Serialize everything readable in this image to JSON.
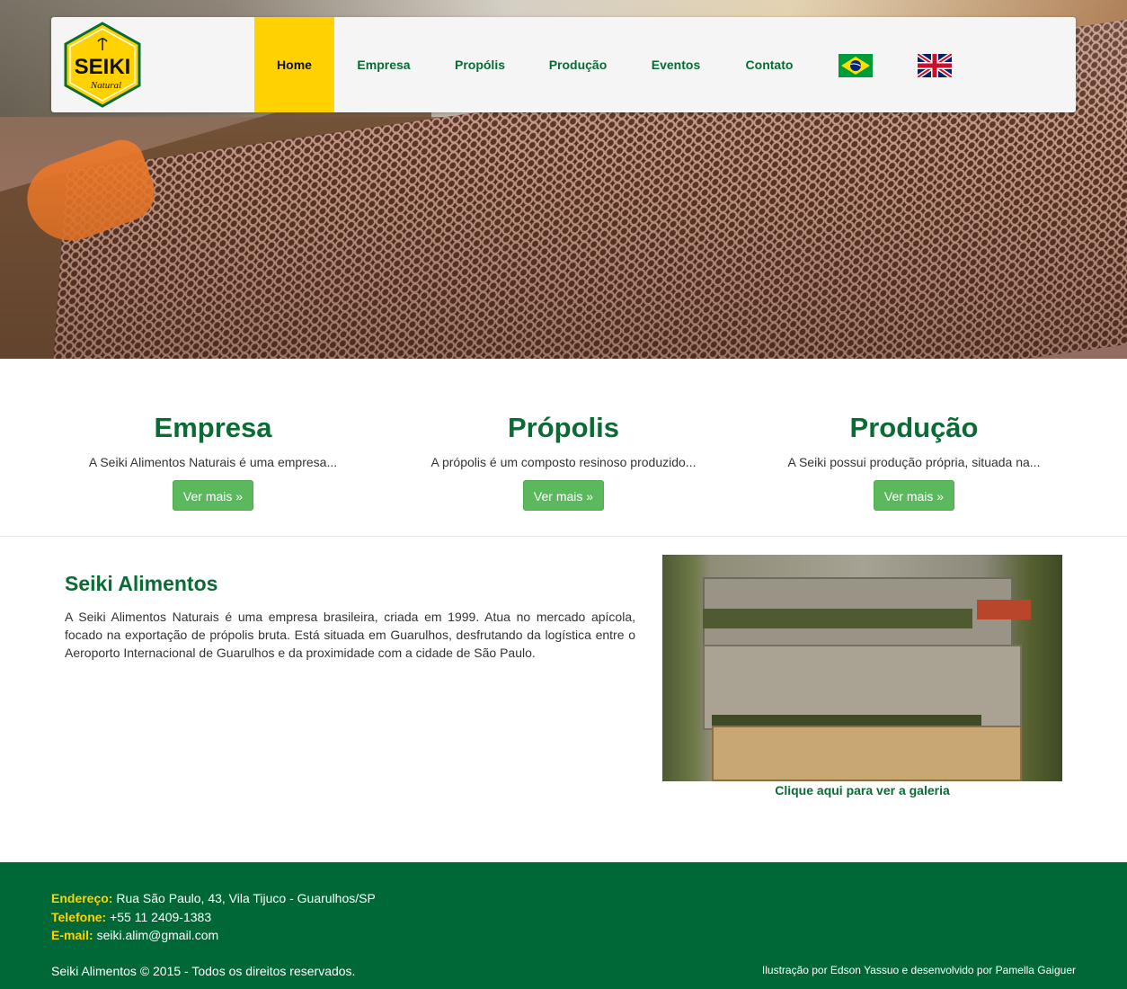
{
  "nav": {
    "logo_text": "SEIKI",
    "logo_subtext": "Natural",
    "items": [
      {
        "label": "Home",
        "active": true
      },
      {
        "label": "Empresa",
        "active": false
      },
      {
        "label": "Propólis",
        "active": false
      },
      {
        "label": "Produção",
        "active": false
      },
      {
        "label": "Eventos",
        "active": false
      },
      {
        "label": "Contato",
        "active": false
      }
    ],
    "flags": [
      "brazil-flag",
      "uk-flag"
    ]
  },
  "features": [
    {
      "title": "Empresa",
      "text": "A Seiki Alimentos Naturais é uma empresa...",
      "button": "Ver mais »"
    },
    {
      "title": "Própolis",
      "text": "A própolis é um composto resinoso produzido...",
      "button": "Ver mais »"
    },
    {
      "title": "Produção",
      "text": "A Seiki possui produção própria, situada na...",
      "button": "Ver mais »"
    }
  ],
  "about": {
    "title": "Seiki Alimentos",
    "text": "A Seiki Alimentos Naturais é uma empresa brasileira, criada em 1999. Atua no mercado apícola, focado na exportação de própolis bruta. Está situada em Guarulhos, desfrutando da logística entre o Aeroporto Internacional de Guarulhos e da proximidade com a cidade de São Paulo.",
    "gallery_link": "Clique aqui para ver a galeria"
  },
  "footer": {
    "address_label": "Endereço:",
    "address": "Rua São Paulo, 43, Vila Tijuco - Guarulhos/SP",
    "phone_label": "Telefone:",
    "phone": "+55 11 2409-1383",
    "email_label": "E-mail:",
    "email": "seiki.alim@gmail.com",
    "copyright": "Seiki Alimentos © 2015 - Todos os direitos reservados.",
    "credits": "Ilustração por Edson Yassuo e desenvolvido por Pamella Gaiguer"
  },
  "colors": {
    "brand_green": "#0a6b34",
    "footer_green": "#006837",
    "accent_yellow": "#ffd200",
    "button_green": "#5cb85c"
  }
}
